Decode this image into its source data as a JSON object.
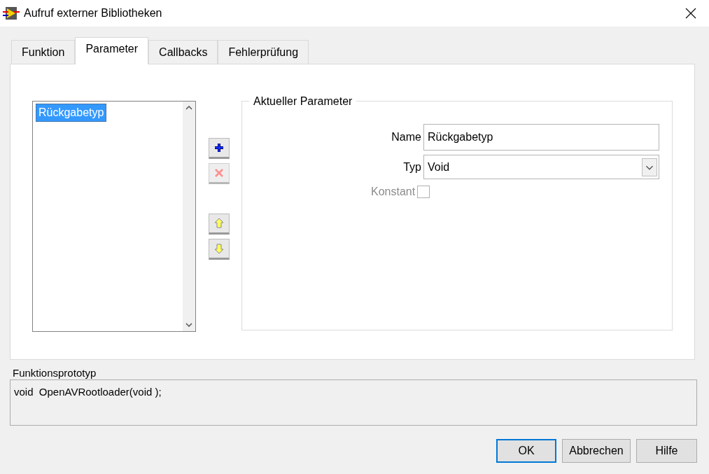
{
  "window": {
    "title": "Aufruf externer Bibliotheken"
  },
  "tabs": [
    {
      "label": "Funktion",
      "selected": false
    },
    {
      "label": "Parameter",
      "selected": true
    },
    {
      "label": "Callbacks",
      "selected": false
    },
    {
      "label": "Fehlerprüfung",
      "selected": false
    }
  ],
  "parameter_list": {
    "items": [
      {
        "label": "Rückgabetyp",
        "selected": true
      }
    ]
  },
  "list_buttons": [
    {
      "kind": "add",
      "disabled": false
    },
    {
      "kind": "delete",
      "disabled": true
    },
    {
      "kind": "up",
      "disabled": false
    },
    {
      "kind": "down",
      "disabled": false
    }
  ],
  "current_parameter": {
    "title": "Aktueller Parameter",
    "name": {
      "label": "Name",
      "value": "Rückgabetyp"
    },
    "type": {
      "label": "Typ",
      "value": "Void"
    },
    "constant": {
      "label": "Konstant",
      "checked": false,
      "disabled": true
    }
  },
  "prototype": {
    "label": "Funktionsprototyp",
    "value": "void  OpenAVRootloader(void );"
  },
  "buttons": [
    {
      "label": "OK",
      "default": true
    },
    {
      "label": "Abbrechen",
      "default": false
    },
    {
      "label": "Hilfe",
      "default": false
    }
  ]
}
